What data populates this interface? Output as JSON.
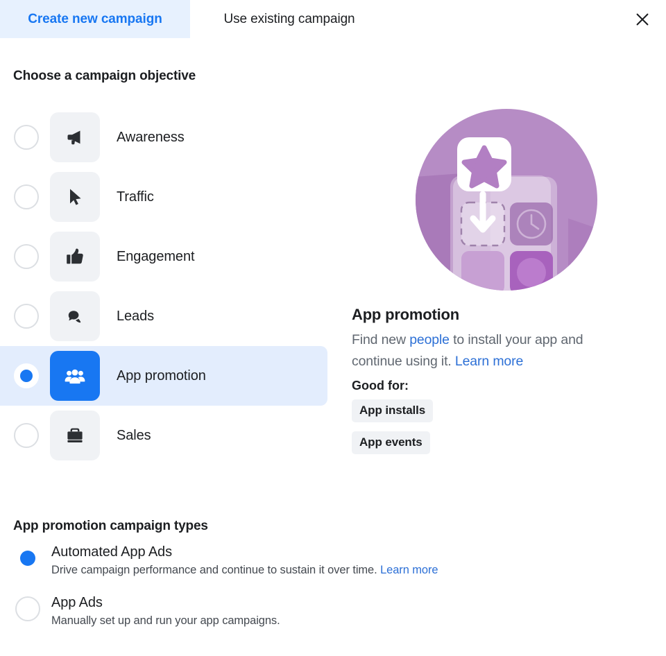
{
  "tabs": [
    {
      "label": "Create new campaign",
      "active": true
    },
    {
      "label": "Use existing campaign",
      "active": false
    }
  ],
  "close_icon": "close-icon",
  "objective_section": {
    "title": "Choose a campaign objective",
    "options": [
      {
        "label": "Awareness",
        "icon": "megaphone-icon",
        "selected": false
      },
      {
        "label": "Traffic",
        "icon": "cursor-icon",
        "selected": false
      },
      {
        "label": "Engagement",
        "icon": "thumbs-up-icon",
        "selected": false
      },
      {
        "label": "Leads",
        "icon": "speech-bubbles-icon",
        "selected": false
      },
      {
        "label": "App promotion",
        "icon": "people-group-icon",
        "selected": true
      },
      {
        "label": "Sales",
        "icon": "briefcase-icon",
        "selected": false
      }
    ]
  },
  "detail": {
    "illustration": "app-promotion-illustration",
    "title": "App promotion",
    "desc_part1": "Find new ",
    "desc_link1": "people",
    "desc_part2": " to install your app and continue using it. ",
    "desc_link2": "Learn more",
    "good_for_label": "Good for:",
    "chips": [
      "App installs",
      "App events"
    ]
  },
  "types_section": {
    "title": "App promotion campaign types",
    "options": [
      {
        "name": "Automated App Ads",
        "desc_text": "Drive campaign performance and continue to sustain it over time. ",
        "desc_link": "Learn more",
        "selected": true
      },
      {
        "name": "App Ads",
        "desc_text": "Manually set up and run your app campaigns.",
        "desc_link": "",
        "selected": false
      }
    ]
  },
  "colors": {
    "accent_blue": "#1877f2",
    "link_blue": "#2d70d6",
    "tab_active_bg": "#e7f1fe",
    "row_selected_bg": "#e3edfd",
    "tile_bg": "#f0f2f5",
    "illustration_purple": "#b58bc4"
  }
}
